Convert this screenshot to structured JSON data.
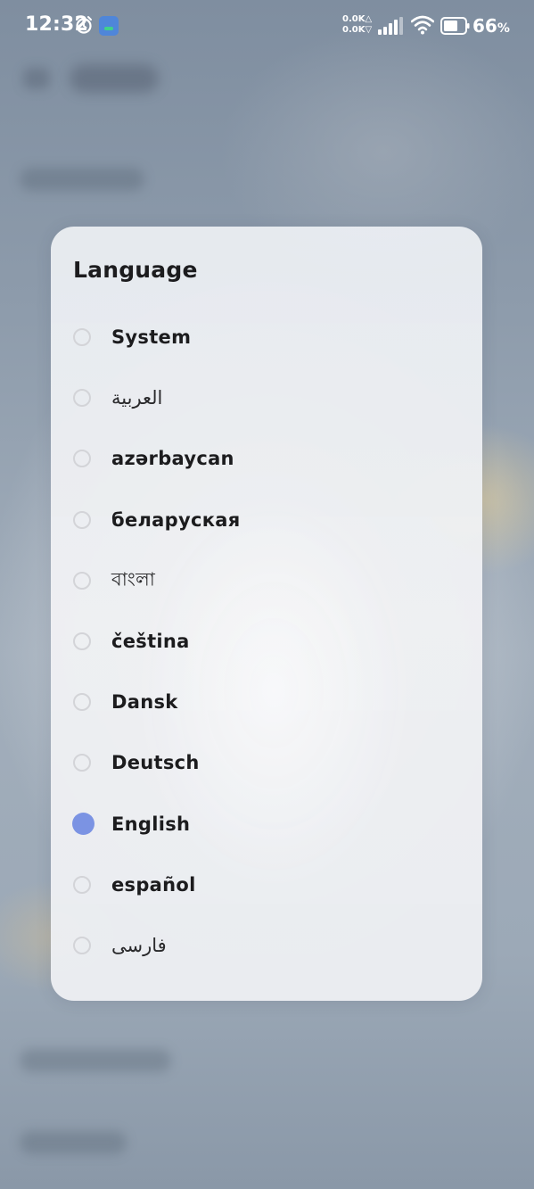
{
  "status_bar": {
    "time": "12:32",
    "net_up": "0.0K△",
    "net_down": "0.0K▽",
    "battery_percent": "66",
    "battery_unit": "%",
    "icons": [
      "alarm-clock-icon",
      "app-notification-icon",
      "signal-icon",
      "wifi-icon",
      "battery-icon"
    ]
  },
  "dialog": {
    "title": "Language",
    "accent_color": "#7b93e3",
    "selected_index": 8,
    "options": [
      {
        "label": "System"
      },
      {
        "label": "العربية"
      },
      {
        "label": "azərbaycan"
      },
      {
        "label": "беларуская"
      },
      {
        "label": "বাংলা"
      },
      {
        "label": "čeština"
      },
      {
        "label": "Dansk"
      },
      {
        "label": "Deutsch"
      },
      {
        "label": "English"
      },
      {
        "label": "español"
      },
      {
        "label": "فارسی"
      }
    ]
  }
}
